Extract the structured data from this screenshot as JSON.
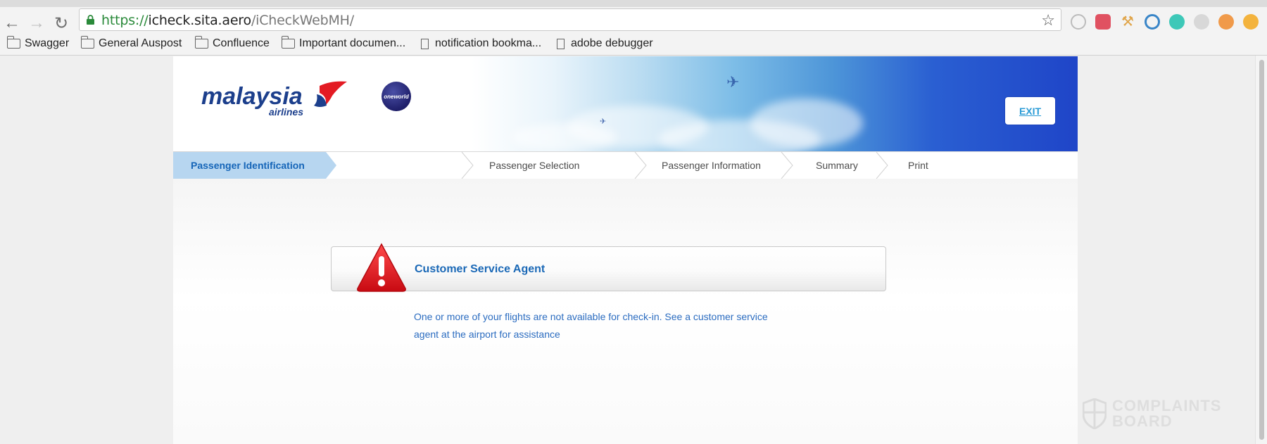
{
  "browser": {
    "url": {
      "scheme": "https://",
      "host": "icheck.sita.aero",
      "path": "/iCheckWebMH/"
    },
    "bookmarks": [
      {
        "label": "Swagger",
        "type": "folder"
      },
      {
        "label": "General Auspost",
        "type": "folder"
      },
      {
        "label": "Confluence",
        "type": "folder"
      },
      {
        "label": "Important documen...",
        "type": "folder"
      },
      {
        "label": "notification bookma...",
        "type": "page"
      },
      {
        "label": "adobe debugger",
        "type": "page"
      }
    ]
  },
  "site": {
    "logo_word": "malaysia",
    "logo_sub": "airlines",
    "oneworld_label": "oneworld",
    "exit_label": "EXIT",
    "steps": [
      "Passenger Identification",
      "Passenger Selection",
      "Passenger Information",
      "Summary",
      "Print"
    ],
    "active_step": 0,
    "alert": {
      "title": "Customer Service Agent",
      "message": "One or more of your flights are not available for check-in. See a customer service agent at the airport for assistance"
    },
    "watermark": {
      "line1": "COMPLAINTS",
      "line2": "BOARD"
    }
  },
  "colors": {
    "accent": "#1a68b6",
    "active_step_bg": "#b7d6f0",
    "warning_red": "#e3131b"
  }
}
